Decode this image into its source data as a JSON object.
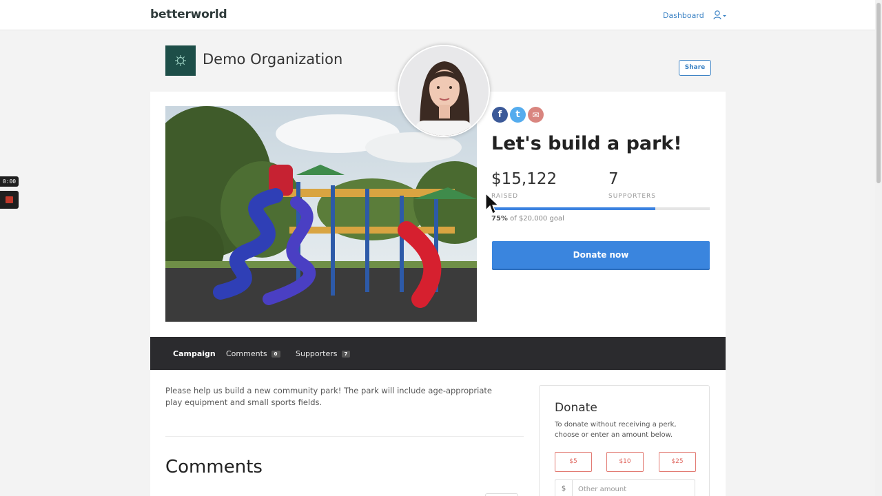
{
  "nav": {
    "brand": "betterworld",
    "dashboard_label": "Dashboard",
    "user_icon": "user-icon"
  },
  "recorder": {
    "time": "0:00"
  },
  "org": {
    "name": "Demo Organization",
    "share_label": "Share"
  },
  "campaign": {
    "title": "Let's build a park!",
    "raised": "$15,122",
    "raised_label": "RAISED",
    "supporters": "7",
    "supporters_label": "SUPPORTERS",
    "progress_percent": 75,
    "progress_pct_text": "75%",
    "goal_text": "of $20,000 goal",
    "donate_label": "Donate now"
  },
  "social": {
    "facebook_glyph": "f",
    "twitter_glyph": "t",
    "email_glyph": "✉"
  },
  "tabs": [
    {
      "label": "Campaign"
    },
    {
      "label": "Comments",
      "count": "0"
    },
    {
      "label": "Supporters",
      "count": "7"
    }
  ],
  "content": {
    "description": "Please help us build a new community park! The park will include age-appropriate play equipment and small sports fields.",
    "comments_heading": "Comments"
  },
  "donate_panel": {
    "title": "Donate",
    "subtitle": "To donate without receiving a perk, choose or enter an amount below.",
    "amounts": [
      "$5",
      "$10",
      "$25"
    ],
    "currency_symbol": "$",
    "other_placeholder": "Other amount"
  },
  "colors": {
    "primary": "#3a85de",
    "dark_bar": "#2b2b2e",
    "org_logo_bg": "#1d4e48",
    "amount_accent": "#e0675f",
    "facebook": "#3b5998",
    "twitter": "#55acee",
    "email": "#d9857f"
  }
}
